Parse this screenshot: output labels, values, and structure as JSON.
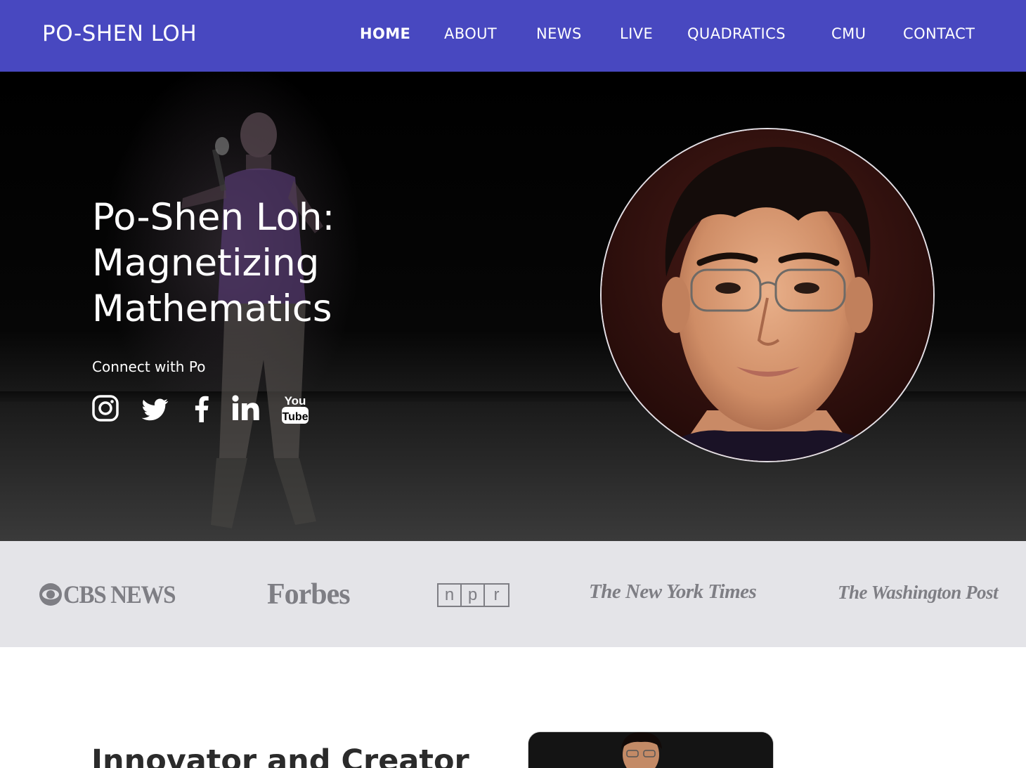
{
  "nav": {
    "brand": "PO-SHEN LOH",
    "items": [
      {
        "label": "HOME",
        "active": true
      },
      {
        "label": "ABOUT",
        "active": false
      },
      {
        "label": "NEWS",
        "active": false
      },
      {
        "label": "LIVE",
        "active": false
      },
      {
        "label": "QUADRATICS",
        "active": false
      },
      {
        "label": "CMU",
        "active": false
      },
      {
        "label": "CONTACT",
        "active": false
      }
    ],
    "background_color": "#4848c0"
  },
  "hero": {
    "title_line1": "Po-Shen Loh:",
    "title_line2": "Magnetizing",
    "title_line3": "Mathematics",
    "connect_label": "Connect with Po",
    "social_icons": [
      "instagram-icon",
      "twitter-icon",
      "facebook-icon",
      "linkedin-icon",
      "youtube-icon"
    ],
    "youtube_icon_text_top": "You",
    "youtube_icon_text_bottom": "Tube"
  },
  "press": {
    "logos": {
      "cbs": "CBS NEWS",
      "forbes": "Forbes",
      "npr": [
        "n",
        "p",
        "r"
      ],
      "nyt": "The New York Times",
      "wapo": "The Washington Post"
    },
    "background_color": "#e4e4e8"
  },
  "section": {
    "title": "Innovator and Creator"
  }
}
